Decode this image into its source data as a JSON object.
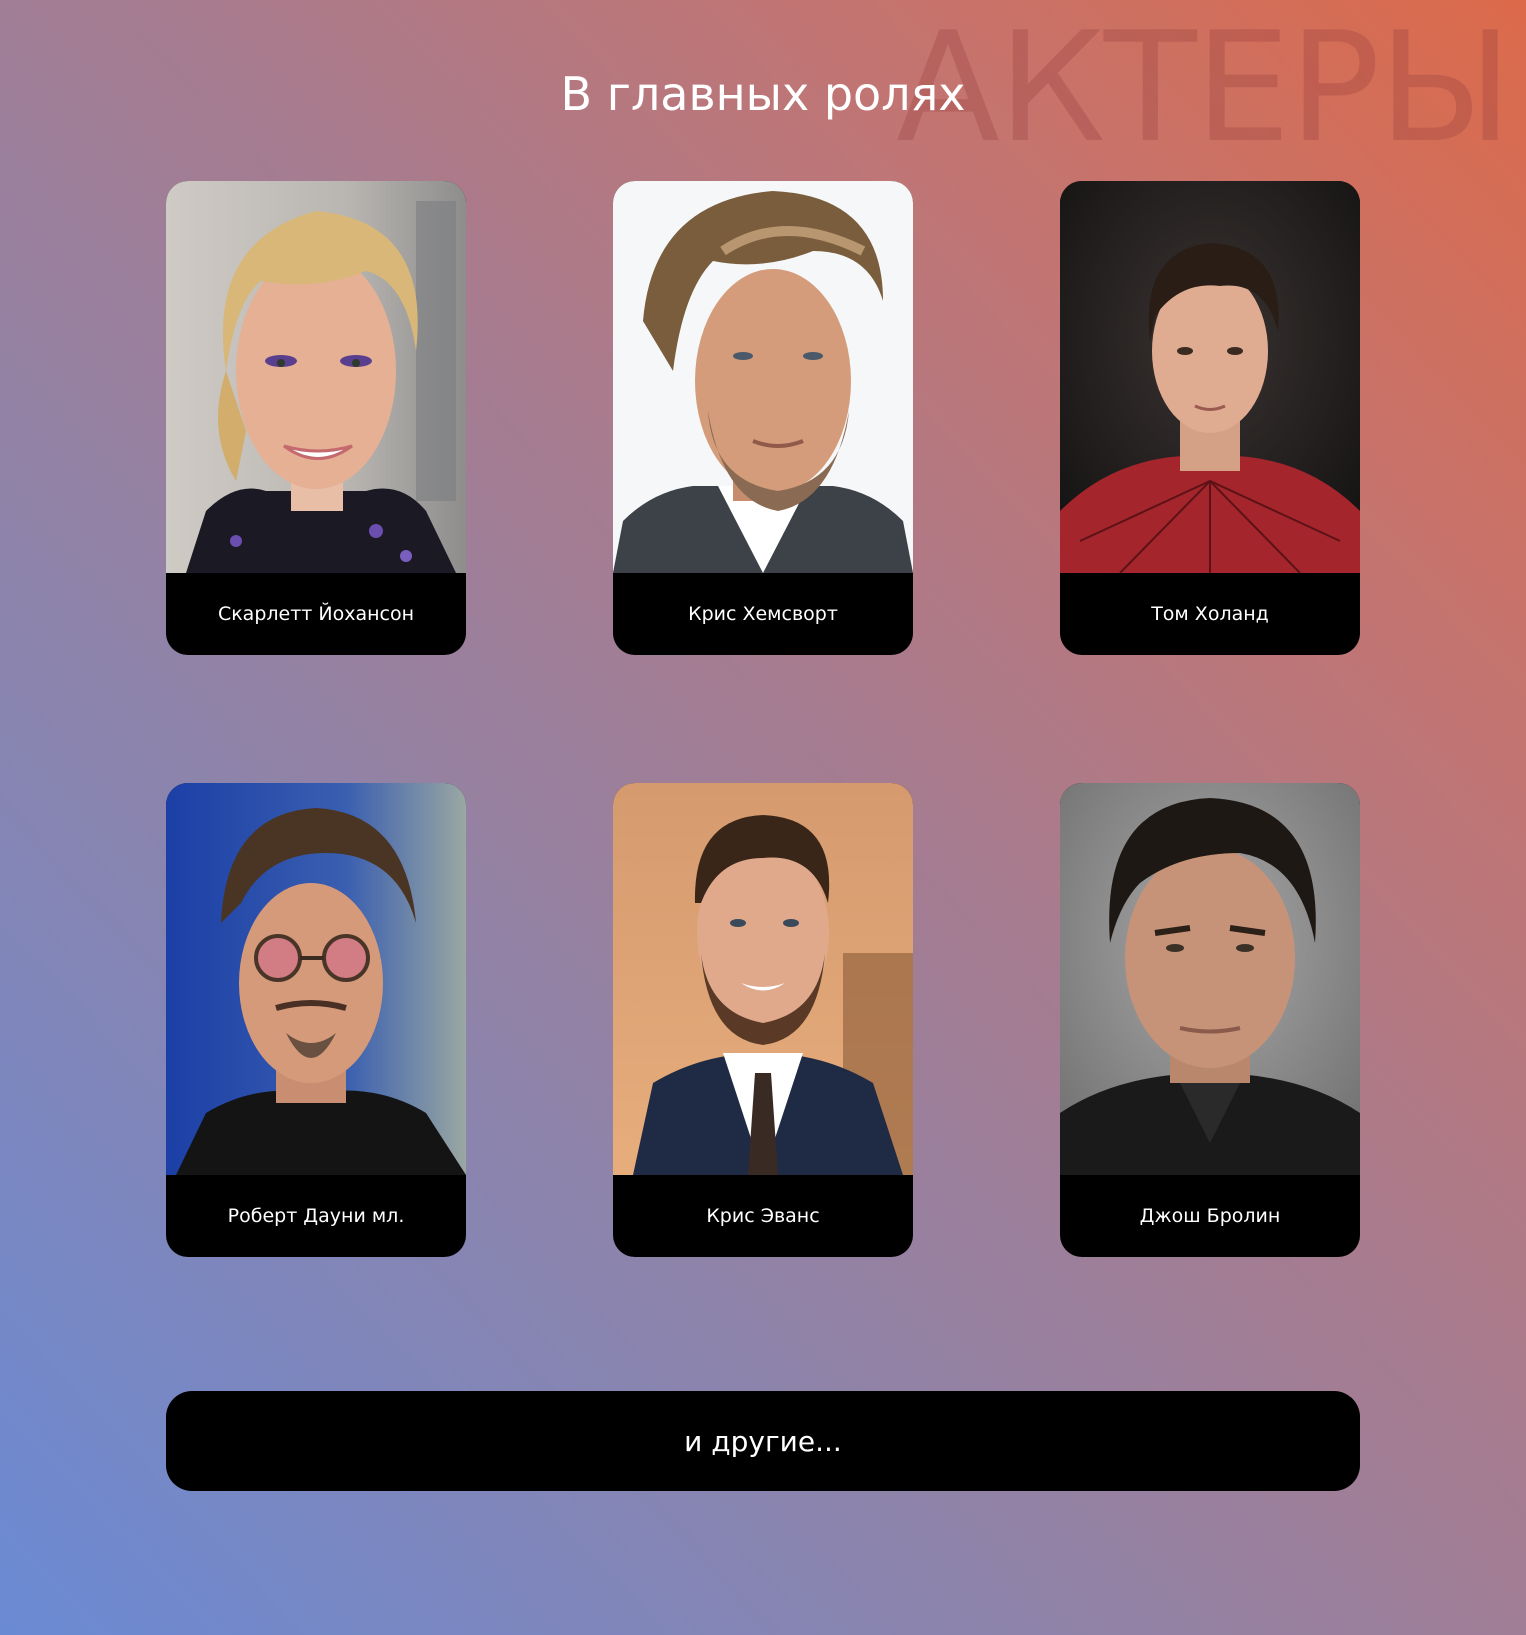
{
  "header": {
    "watermark": "АКТЕРЫ",
    "title": "В главных ролях"
  },
  "actors": [
    {
      "name": "Скарлетт Йохансон",
      "photo_icon": "portrait-photo"
    },
    {
      "name": "Крис Хемсворт",
      "photo_icon": "portrait-photo"
    },
    {
      "name": "Том Холанд",
      "photo_icon": "portrait-photo"
    },
    {
      "name": "Роберт Дауни мл.",
      "photo_icon": "portrait-photo"
    },
    {
      "name": "Крис Эванс",
      "photo_icon": "portrait-photo"
    },
    {
      "name": "Джош Бролин",
      "photo_icon": "portrait-photo"
    }
  ],
  "more_button": {
    "label": "и другие..."
  },
  "colors": {
    "gradient_bottom_left": "#6a8ad4",
    "gradient_top_right": "#dc6a4a",
    "card_background": "#000000",
    "text": "#ffffff"
  }
}
